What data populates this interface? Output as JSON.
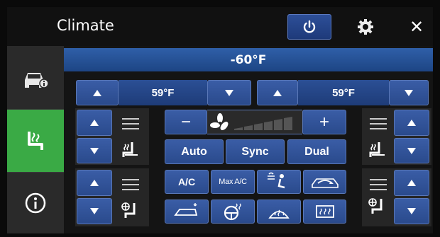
{
  "header": {
    "title": "Climate"
  },
  "zone_temp": "-60°F",
  "left_set": "59°F",
  "right_set": "59°F",
  "fan": {
    "minus": "−",
    "plus": "+",
    "level": 0
  },
  "modes": {
    "auto": "Auto",
    "sync": "Sync",
    "dual": "Dual"
  },
  "ac": {
    "ac": "A/C",
    "max_ac": "Max A/C"
  },
  "colors": {
    "accent": "#2a4a8c",
    "active_side": "#3aaa45",
    "temp_bar": "#2f5fa8"
  }
}
